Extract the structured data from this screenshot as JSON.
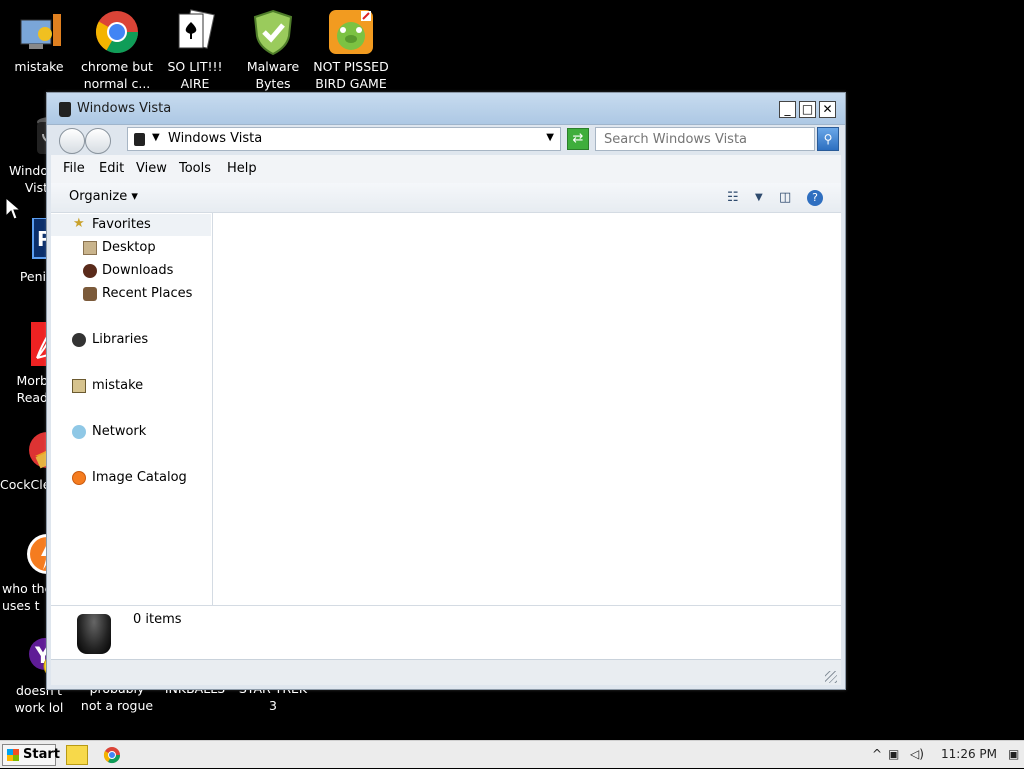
{
  "desktop_icons": [
    {
      "label": "mistake"
    },
    {
      "label": "chrome but normal c..."
    },
    {
      "label": "SO LIT!!! AIRE"
    },
    {
      "label": "Malware Bytes"
    },
    {
      "label": "NOT PISSED BIRD GAME"
    },
    {
      "label": "Windo Vist"
    },
    {
      "label": "Peni"
    },
    {
      "label": "Morb Read"
    },
    {
      "label": "CockCle"
    },
    {
      "label": "who the uses t"
    },
    {
      "label": "doesn't work lol"
    },
    {
      "label": "probably not a rogue"
    },
    {
      "label": "INKBALLS"
    },
    {
      "label": "STAR TREK 3"
    }
  ],
  "window": {
    "title": "Windows Vista",
    "address": "Windows Vista",
    "search_placeholder": "Search Windows Vista",
    "menu": [
      "File",
      "Edit",
      "View",
      "Tools",
      "Help"
    ],
    "organize_label": "Organize",
    "nav": {
      "favorites": "Favorites",
      "desktop": "Desktop",
      "downloads": "Downloads",
      "recent": "Recent Places",
      "libraries": "Libraries",
      "mistake": "mistake",
      "network": "Network",
      "image_catalog": "Image Catalog"
    },
    "item_count": "0 items"
  },
  "taskbar": {
    "start_label": "Start",
    "time": "11:26 PM"
  }
}
